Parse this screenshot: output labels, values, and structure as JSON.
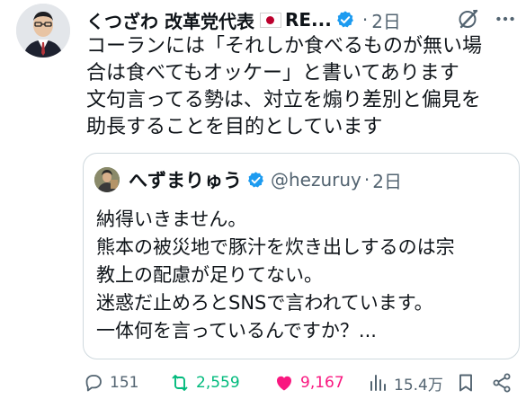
{
  "tweet": {
    "author_name": "くつざわ 改革党代表",
    "author_name_suffix": "RE...",
    "separator": "·",
    "time": "2日",
    "body_lines": [
      "コーランには「それしか食べるものが無い場",
      "合は食べてもオッケー」と書いてあります",
      "文句言ってる勢は、対立を煽り差別と偏見を",
      "助長することを目的としています"
    ]
  },
  "quoted": {
    "author_name": "へずまりゅう",
    "handle": "@hezuruy",
    "separator": "·",
    "time": "2日",
    "body_lines": [
      "納得いきません。",
      "熊本の被災地で豚汁を炊き出しするのは宗",
      "教上の配慮が足りてない。",
      "迷惑だ止めろとSNSで言われています。",
      "一体何を言っているんですか？..."
    ]
  },
  "actions": {
    "replies": "151",
    "reposts": "2,559",
    "likes": "9,167",
    "views": "15.4万"
  },
  "icons": {
    "verified": "verified-badge-icon",
    "flag": "japan-flag-icon",
    "grok": "grok-icon",
    "more": "more-icon",
    "reply": "reply-icon",
    "repost": "repost-icon",
    "like": "heart-icon",
    "views": "views-icon",
    "bookmark": "bookmark-icon",
    "share": "share-icon"
  },
  "colors": {
    "text": "#0f1419",
    "muted": "#536471",
    "verified": "#1d9bf0",
    "repost_active": "#00ba7c",
    "like_active": "#f91880",
    "border": "#cfd9de"
  }
}
